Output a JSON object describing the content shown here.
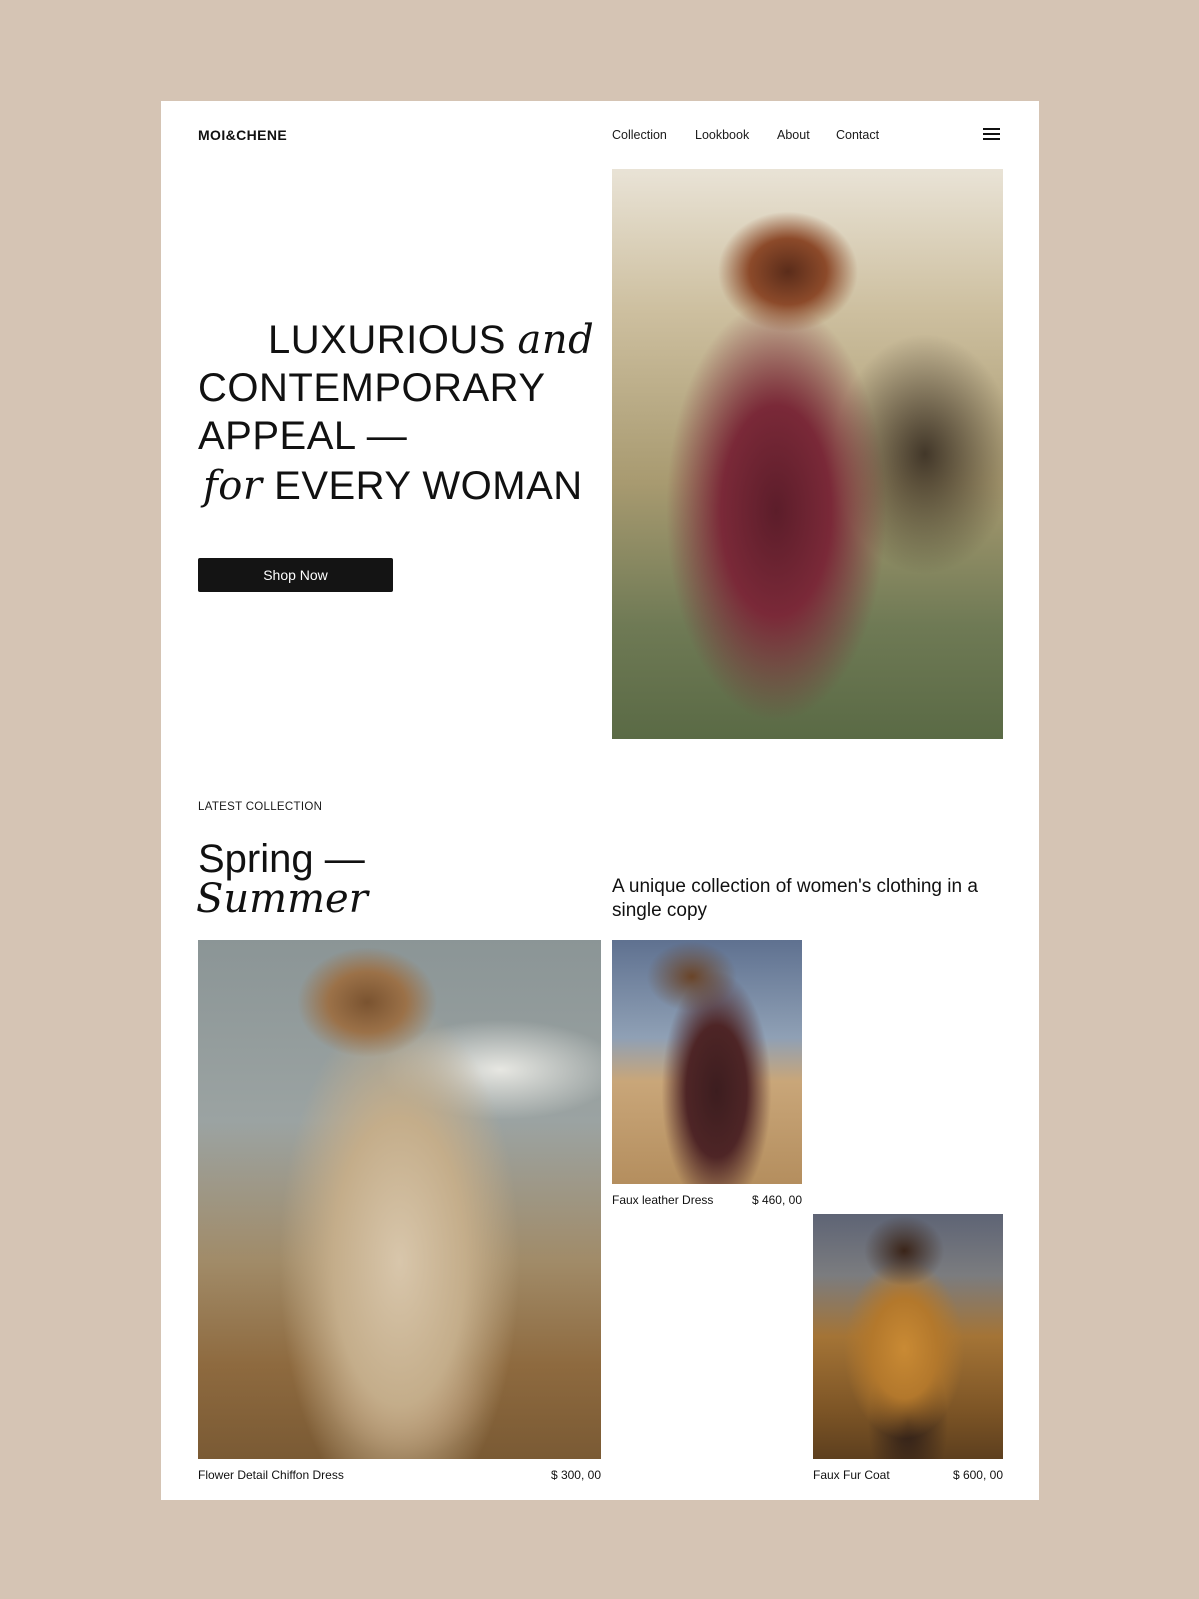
{
  "brand": {
    "logo": "MOI&CHENE"
  },
  "nav": {
    "items": [
      "Collection",
      "Lookbook",
      "About",
      "Contact"
    ],
    "menu_icon": "hamburger-icon"
  },
  "hero": {
    "line1_upright": "LUXURIOUS",
    "line1_italic": "and",
    "line2": "CONTEMPORARY",
    "line3": "APPEAL —",
    "line4_italic": "for",
    "line4_upright": "EVERY WOMAN",
    "cta_label": "Shop Now"
  },
  "collection": {
    "eyebrow": "LATEST COLLECTION",
    "title_upright": "Spring —",
    "title_italic": "Summer",
    "tagline": "A unique collection of women's clothing in a single copy",
    "products": [
      {
        "name": "Faux leather Dress",
        "price": "$ 460, 00"
      },
      {
        "name": "Flower Detail Chiffon Dress",
        "price": "$ 300, 00"
      },
      {
        "name": "Faux Fur Coat",
        "price": "$ 600, 00"
      }
    ]
  },
  "colors": {
    "background": "#d5c4b4",
    "card": "#ffffff",
    "button": "#141414",
    "text": "#111111"
  }
}
